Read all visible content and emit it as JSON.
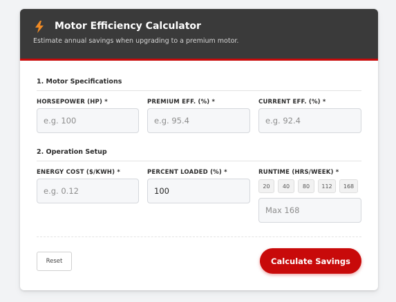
{
  "header": {
    "title": "Motor Efficiency Calculator",
    "subtitle": "Estimate annual savings when upgrading to a premium motor.",
    "icon": "lightning-bolt-icon",
    "accent_color": "#c80a0a",
    "icon_color": "#f08a24"
  },
  "motor_specs": {
    "section_title": "1. Motor Specifications",
    "horsepower": {
      "label": "HORSEPOWER (HP) *",
      "placeholder": "e.g. 100",
      "value": ""
    },
    "premium_eff": {
      "label": "PREMIUM EFF. (%) *",
      "placeholder": "e.g. 95.4",
      "value": ""
    },
    "current_eff": {
      "label": "CURRENT EFF. (%) *",
      "placeholder": "e.g. 92.4",
      "value": ""
    }
  },
  "operation": {
    "section_title": "2. Operation Setup",
    "energy_cost": {
      "label": "ENERGY COST ($/KWH) *",
      "placeholder": "e.g. 0.12",
      "value": ""
    },
    "percent_loaded": {
      "label": "PERCENT LOADED (%) *",
      "placeholder": "",
      "value": "100"
    },
    "runtime": {
      "label": "RUNTIME (HRS/WEEK) *",
      "placeholder": "Max 168",
      "value": "",
      "presets": [
        "20",
        "40",
        "80",
        "112",
        "168"
      ]
    }
  },
  "actions": {
    "reset_label": "Reset",
    "calculate_label": "Calculate Savings"
  }
}
